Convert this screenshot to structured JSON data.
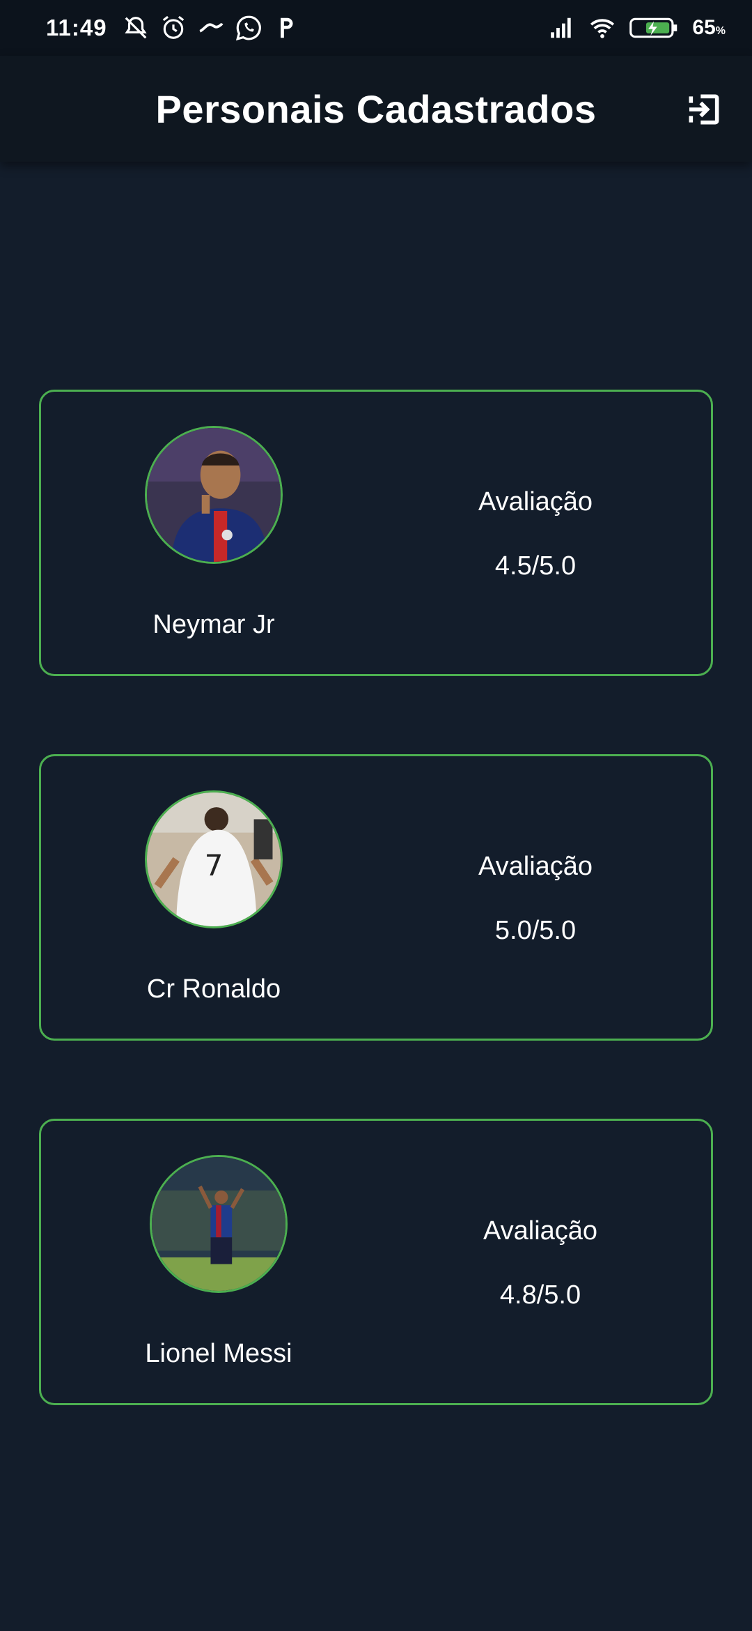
{
  "status_bar": {
    "time": "11:49",
    "battery": "65",
    "battery_unit": "%",
    "icons": [
      "muted-icon",
      "alarm-icon",
      "ifood-icon",
      "whatsapp-icon",
      "p-icon",
      "signal-icon",
      "wifi-icon",
      "battery-icon"
    ]
  },
  "app_bar": {
    "title": "Personais Cadastrados",
    "logout_icon": "logout-icon"
  },
  "trainers": [
    {
      "name": "Neymar Jr",
      "rating_label": "Avaliação",
      "rating": "4.5/5.0"
    },
    {
      "name": "Cr Ronaldo",
      "rating_label": "Avaliação",
      "rating": "5.0/5.0"
    },
    {
      "name": "Lionel Messi",
      "rating_label": "Avaliação",
      "rating": "4.8/5.0"
    }
  ],
  "colors": {
    "background": "#131d2b",
    "app_bar": "#0f1720",
    "accent": "#4caf50",
    "text": "#ffffff"
  }
}
